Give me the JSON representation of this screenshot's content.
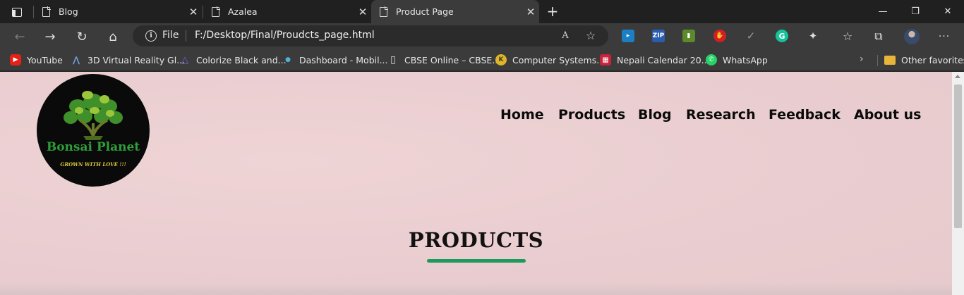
{
  "browser": {
    "tabs": [
      {
        "title": "Blog",
        "close": "✕"
      },
      {
        "title": "Azalea",
        "close": "✕"
      },
      {
        "title": "Product Page",
        "close": "✕"
      }
    ],
    "new_tab": "+",
    "window_controls": {
      "minimize": "—",
      "restore": "❐",
      "close": "✕"
    },
    "nav": {
      "back": "←",
      "forward": "→",
      "refresh": "↻",
      "home": "⌂"
    },
    "address": {
      "scheme_label": "File",
      "url": "F:/Desktop/Final/Proudcts_page.html",
      "read_aloud": "A",
      "add_favorite": "☆"
    },
    "extensions": [
      "bitwarden-icon",
      "zip-icon",
      "clipboard-icon",
      "adblock-icon",
      "check-icon",
      "grammarly-icon",
      "puzzle-icon"
    ],
    "ext_labels": {
      "zip": "ZIP",
      "adblock": "✋",
      "check": "✓",
      "grammarly": "G",
      "puzzle": "✦"
    },
    "tools": {
      "favorites": "☆",
      "collections": "⧉",
      "more": "···"
    },
    "bookmarks": [
      {
        "label": "YouTube",
        "icon": "youtube-icon",
        "glyph": "▶",
        "color": "#e62117"
      },
      {
        "label": "3D Virtual Reality Gl...",
        "icon": "vr-icon",
        "glyph": "⋀",
        "color": "#3a6ea5"
      },
      {
        "label": "Colorize Black and...",
        "icon": "colorize-icon",
        "glyph": "△",
        "color": "#5b3fa0"
      },
      {
        "label": "Dashboard - Mobil...",
        "icon": "dashboard-icon",
        "glyph": "●",
        "color": "#2a8fb0"
      },
      {
        "label": "CBSE Online – CBSE...",
        "icon": "document-icon",
        "glyph": "▯",
        "color": "#3b3b3b"
      },
      {
        "label": "Computer Systems...",
        "icon": "computer-systems-icon",
        "glyph": "K",
        "color": "#e0b526"
      },
      {
        "label": "Nepali Calendar 20...",
        "icon": "calendar-icon",
        "glyph": "▦",
        "color": "#c8233a"
      },
      {
        "label": "WhatsApp",
        "icon": "whatsapp-icon",
        "glyph": "✆",
        "color": "#25d366"
      }
    ],
    "bookmarks_overflow": "›",
    "other_favorites": "Other favorites"
  },
  "page": {
    "logo": {
      "brand": "Bonsai Planet",
      "tagline": "GROWN WITH LOVE !!!"
    },
    "nav": [
      "Home",
      "Products",
      "Blog",
      "Research",
      "Feedback",
      "About us"
    ],
    "section_title": "PRODUCTS"
  },
  "colors": {
    "page_bg": "#ebcfd2",
    "accent_underline": "#1c9a5c",
    "browser_dark": "#202020",
    "toolbar": "#3b3b3b"
  }
}
